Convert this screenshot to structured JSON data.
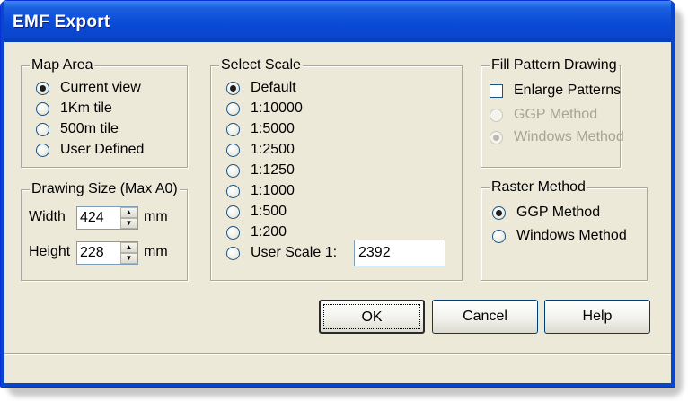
{
  "window": {
    "title": "EMF Export"
  },
  "map_area": {
    "label": "Map Area",
    "options": [
      "Current view",
      "1Km tile",
      "500m tile",
      "User Defined"
    ],
    "selected": "Current view"
  },
  "drawing_size": {
    "label": "Drawing Size (Max A0)",
    "width_label": "Width",
    "width_value": "424",
    "height_label": "Height",
    "height_value": "228",
    "unit": "mm"
  },
  "select_scale": {
    "label": "Select Scale",
    "options": [
      "Default",
      "1:10000",
      "1:5000",
      "1:2500",
      "1:1250",
      "1:1000",
      "1:500",
      "1:200",
      "User Scale 1:"
    ],
    "selected": "Default",
    "user_scale_value": "2392"
  },
  "fill_pattern": {
    "label": "Fill Pattern Drawing",
    "enlarge_label": "Enlarge Patterns",
    "options": [
      "GGP Method",
      "Windows Method"
    ],
    "selected": "Windows Method"
  },
  "raster_method": {
    "label": "Raster Method",
    "options": [
      "GGP Method",
      "Windows Method"
    ],
    "selected": "GGP Method"
  },
  "buttons": {
    "ok": "OK",
    "cancel": "Cancel",
    "help": "Help"
  }
}
